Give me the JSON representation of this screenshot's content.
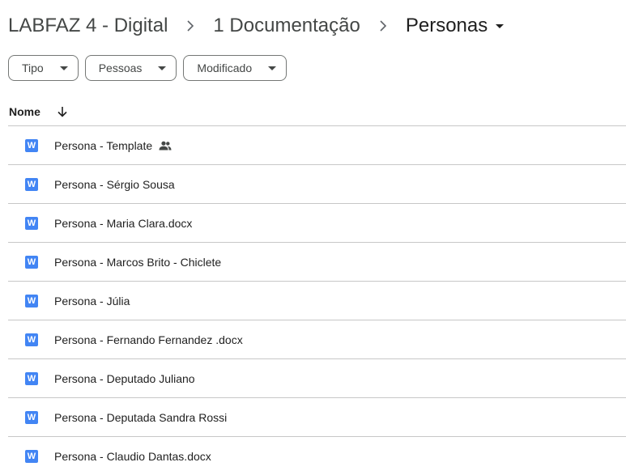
{
  "breadcrumb": {
    "items": [
      "LABFAZ 4 - Digital",
      "1 Documentação"
    ],
    "current": "Personas"
  },
  "filters": [
    {
      "label": "Tipo"
    },
    {
      "label": "Pessoas"
    },
    {
      "label": "Modificado"
    }
  ],
  "list_header": {
    "name_label": "Nome"
  },
  "files": [
    {
      "name": "Persona - Template",
      "icon_letter": "W",
      "shared": true
    },
    {
      "name": "Persona - Sérgio Sousa",
      "icon_letter": "W",
      "shared": false
    },
    {
      "name": "Persona - Maria Clara.docx",
      "icon_letter": "W",
      "shared": false
    },
    {
      "name": "Persona - Marcos Brito - Chiclete",
      "icon_letter": "W",
      "shared": false
    },
    {
      "name": "Persona - Júlia",
      "icon_letter": "W",
      "shared": false
    },
    {
      "name": "Persona - Fernando Fernandez .docx",
      "icon_letter": "W",
      "shared": false
    },
    {
      "name": "Persona - Deputado Juliano",
      "icon_letter": "W",
      "shared": false
    },
    {
      "name": "Persona - Deputada Sandra Rossi",
      "icon_letter": "W",
      "shared": false
    },
    {
      "name": "Persona - Claudio Dantas.docx",
      "icon_letter": "W",
      "shared": false
    }
  ],
  "colors": {
    "doc_icon": "#4285f4",
    "divider": "#c7c7c7",
    "chip_border": "#747775"
  }
}
